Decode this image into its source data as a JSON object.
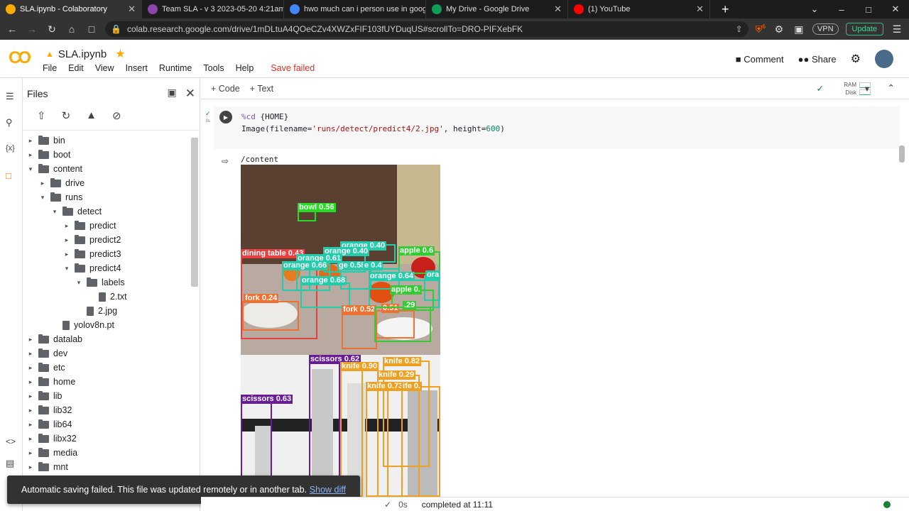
{
  "browser": {
    "tabs": [
      {
        "title": "SLA.ipynb - Colaboratory",
        "icon": "colab-icon",
        "color": "#f9ab00"
      },
      {
        "title": "Team SLA - v 3 2023-05-20 4:21am >",
        "icon": "roboflow-icon",
        "color": "#8e44ad"
      },
      {
        "title": "hwo much can i person use in google",
        "icon": "google-icon",
        "color": "#4285f4"
      },
      {
        "title": "My Drive - Google Drive",
        "icon": "drive-icon",
        "color": "#0f9d58"
      },
      {
        "title": "(1) YouTube",
        "icon": "youtube-icon",
        "color": "#ff0000"
      }
    ],
    "url": "colab.research.google.com/drive/1mDLtuA4QOeCZv4XWZxFIF103fUYDuqUS#scrollTo=DRO-PIFXebFK",
    "vpn_label": "VPN",
    "update_label": "Update",
    "brave_badge": "6"
  },
  "colab": {
    "notebook_title": "SLA.ipynb",
    "menus": [
      "File",
      "Edit",
      "View",
      "Insert",
      "Runtime",
      "Tools",
      "Help"
    ],
    "save_status": "Save failed",
    "comment_label": "Comment",
    "share_label": "Share"
  },
  "files": {
    "title": "Files",
    "tree": [
      {
        "name": "bin",
        "depth": 0,
        "type": "folder",
        "state": "collapsed"
      },
      {
        "name": "boot",
        "depth": 0,
        "type": "folder",
        "state": "collapsed"
      },
      {
        "name": "content",
        "depth": 0,
        "type": "folder",
        "state": "expanded"
      },
      {
        "name": "drive",
        "depth": 1,
        "type": "folder",
        "state": "collapsed"
      },
      {
        "name": "runs",
        "depth": 1,
        "type": "folder",
        "state": "expanded"
      },
      {
        "name": "detect",
        "depth": 2,
        "type": "folder",
        "state": "expanded"
      },
      {
        "name": "predict",
        "depth": 3,
        "type": "folder",
        "state": "collapsed"
      },
      {
        "name": "predict2",
        "depth": 3,
        "type": "folder",
        "state": "collapsed"
      },
      {
        "name": "predict3",
        "depth": 3,
        "type": "folder",
        "state": "collapsed"
      },
      {
        "name": "predict4",
        "depth": 3,
        "type": "folder",
        "state": "expanded"
      },
      {
        "name": "labels",
        "depth": 4,
        "type": "folder",
        "state": "expanded"
      },
      {
        "name": "2.txt",
        "depth": 5,
        "type": "file",
        "state": "none"
      },
      {
        "name": "2.jpg",
        "depth": 4,
        "type": "file",
        "state": "none"
      },
      {
        "name": "yolov8n.pt",
        "depth": 2,
        "type": "file",
        "state": "none"
      },
      {
        "name": "datalab",
        "depth": 0,
        "type": "folder",
        "state": "collapsed"
      },
      {
        "name": "dev",
        "depth": 0,
        "type": "folder",
        "state": "collapsed"
      },
      {
        "name": "etc",
        "depth": 0,
        "type": "folder",
        "state": "collapsed"
      },
      {
        "name": "home",
        "depth": 0,
        "type": "folder",
        "state": "collapsed"
      },
      {
        "name": "lib",
        "depth": 0,
        "type": "folder",
        "state": "collapsed"
      },
      {
        "name": "lib32",
        "depth": 0,
        "type": "folder",
        "state": "collapsed"
      },
      {
        "name": "lib64",
        "depth": 0,
        "type": "folder",
        "state": "collapsed"
      },
      {
        "name": "libx32",
        "depth": 0,
        "type": "folder",
        "state": "collapsed"
      },
      {
        "name": "media",
        "depth": 0,
        "type": "folder",
        "state": "collapsed"
      },
      {
        "name": "mnt",
        "depth": 0,
        "type": "folder",
        "state": "collapsed"
      }
    ]
  },
  "toolbar": {
    "code_label": "+ Code",
    "text_label": "+ Text",
    "ram_label": "RAM",
    "disk_label": "Disk"
  },
  "cell": {
    "exec_time": "0s",
    "line1_magic": "%cd",
    "line1_arg": " {HOME}",
    "line2_fn": "Image(filename=",
    "line2_str": "'runs/detect/predict4/2.jpg'",
    "line2_mid": ", height=",
    "line2_num": "600",
    "line2_end": ")",
    "output_text": "/content"
  },
  "detections_image1": [
    {
      "label": "bowl 0.56",
      "color": "#22dd22"
    },
    {
      "label": "orange 0.40",
      "color": "#22ccaa"
    },
    {
      "label": "orange 0.40",
      "color": "#22ccaa"
    },
    {
      "label": "apple 0.6",
      "color": "#33cc33"
    },
    {
      "label": "dining table 0.43",
      "color": "#e84040"
    },
    {
      "label": "orange 0.61",
      "color": "#22ccaa"
    },
    {
      "label": "orange 0.66",
      "color": "#22ccaa"
    },
    {
      "label": "ge 0.58",
      "color": "#22ccaa"
    },
    {
      "label": "e 0.4",
      "color": "#22ccaa"
    },
    {
      "label": "orange 0.64",
      "color": "#22ccaa"
    },
    {
      "label": "orange 0.68",
      "color": "#22ccaa"
    },
    {
      "label": "ora",
      "color": "#22ccaa"
    },
    {
      "label": "apple 0.",
      "color": "#33cc33"
    },
    {
      "label": "fork 0.24",
      "color": "#f07030"
    },
    {
      "label": "fork 0.52",
      "color": "#f07030"
    },
    {
      "label": "0.51",
      "color": "#f07030"
    },
    {
      "label": ".29",
      "color": "#33cc33"
    }
  ],
  "detections_image2": [
    {
      "label": "scissors 0.62",
      "color": "#6a1b9a"
    },
    {
      "label": "knife 0.90",
      "color": "#f0a020"
    },
    {
      "label": "knife 0.82",
      "color": "#f0a020"
    },
    {
      "label": "knife 0.29",
      "color": "#f0a020"
    },
    {
      "label": "knife 0.73",
      "color": "#f0a020"
    },
    {
      "label": "ife 0.",
      "color": "#f0a020"
    },
    {
      "label": "scissors 0.63",
      "color": "#6a1b9a"
    }
  ],
  "toast": {
    "message": "Automatic saving failed. This file was updated remotely or in another tab.",
    "action": "Show diff"
  },
  "status": {
    "check_time": "0s",
    "completed": "completed at 11:11"
  }
}
